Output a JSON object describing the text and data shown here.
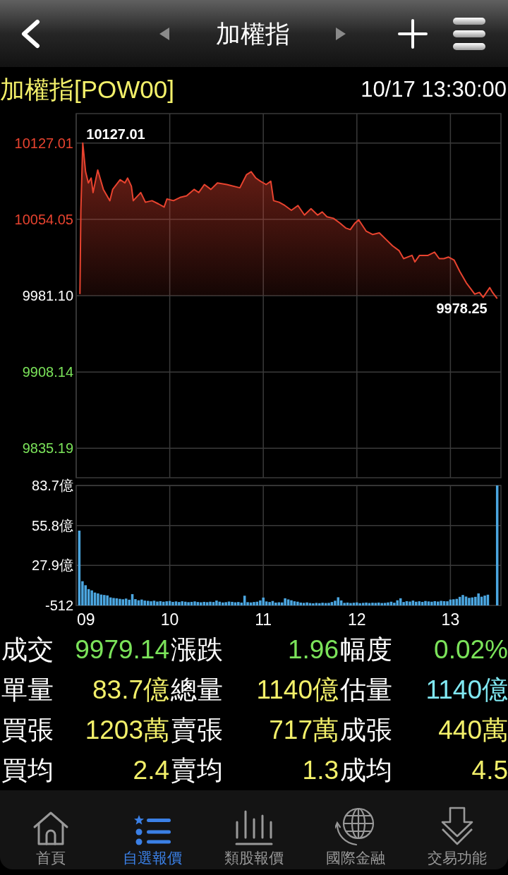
{
  "header": {
    "title": "加權指"
  },
  "quote": {
    "name": "加權指[POW00]",
    "time": "10/17 13:30:00"
  },
  "price_chart": {
    "chart_data": {
      "type": "area",
      "grid": true,
      "x": [
        9.04,
        9.05,
        9.07,
        9.1,
        9.13,
        9.16,
        9.18,
        9.23,
        9.29,
        9.36,
        9.39,
        9.47,
        9.52,
        9.55,
        9.59,
        9.61,
        9.69,
        9.74,
        9.81,
        9.88,
        9.94,
        9.97,
        10.04,
        10.11,
        10.18,
        10.26,
        10.31,
        10.37,
        10.44,
        10.51,
        10.61,
        10.75,
        10.82,
        10.87,
        10.92,
        10.97,
        11.03,
        11.08,
        11.11,
        11.17,
        11.23,
        11.3,
        11.37,
        11.44,
        11.51,
        11.58,
        11.63,
        11.68,
        11.75,
        11.82,
        11.88,
        11.93,
        11.98,
        12.02,
        12.1,
        12.17,
        12.24,
        12.31,
        12.38,
        12.45,
        12.5,
        12.59,
        12.62,
        12.67,
        12.76,
        12.83,
        12.88,
        12.93,
        12.98,
        13.04,
        13.1,
        13.17,
        13.26,
        13.31,
        13.35,
        13.42,
        13.45,
        13.5
      ],
      "series": [
        {
          "color": "#e8432f",
          "values": [
            9982.6,
            10062.7,
            10127.0,
            10099.6,
            10088.9,
            10093.5,
            10079.6,
            10101.2,
            10082.7,
            10071.9,
            10082.7,
            10091.9,
            10088.9,
            10093.5,
            10085.8,
            10071.9,
            10079.6,
            10070.4,
            10071.9,
            10068.8,
            10065.8,
            10073.5,
            10071.9,
            10075.0,
            10076.5,
            10082.7,
            10079.6,
            10087.3,
            10082.7,
            10088.9,
            10087.3,
            10084.2,
            10096.6,
            10099.6,
            10093.5,
            10090.4,
            10087.3,
            10090.4,
            10071.9,
            10070.4,
            10067.3,
            10062.7,
            10067.3,
            10058.1,
            10064.2,
            10058.1,
            10061.1,
            10056.5,
            10055.0,
            10050.4,
            10045.8,
            10044.2,
            10050.4,
            10053.5,
            10042.7,
            10039.6,
            10041.1,
            10035.0,
            10028.8,
            10024.2,
            10016.5,
            10019.6,
            10013.4,
            10019.6,
            10019.6,
            10022.7,
            10016.5,
            10016.5,
            10018.0,
            10015.0,
            10004.2,
            9993.4,
            9982.6,
            9984.2,
            9979.5,
            9988.8,
            9984.2,
            9978.3
          ]
        }
      ],
      "xlim": [
        9,
        13.54
      ],
      "ylim": [
        9807.1,
        10155.1
      ],
      "yticks": [
        {
          "value": 10127.01,
          "label": "10127.01"
        },
        {
          "value": 10054.05,
          "label": "10054.05"
        },
        {
          "value": 9981.1,
          "label": "9981.10"
        },
        {
          "value": 9908.14,
          "label": "9908.14"
        },
        {
          "value": 9835.19,
          "label": "9835.19"
        }
      ],
      "annotations": [
        {
          "text": "10127.01",
          "x": 9.07,
          "y": 10127.01
        },
        {
          "text": "9978.25",
          "x": 13.5,
          "y": 9978.25
        }
      ]
    }
  },
  "volume_chart": {
    "baseline_label": "-512",
    "chart_data": {
      "type": "bar",
      "grid": true,
      "x": [
        9.033,
        9.067,
        9.1,
        9.133,
        9.167,
        9.2,
        9.233,
        9.267,
        9.3,
        9.333,
        9.367,
        9.4,
        9.433,
        9.467,
        9.5,
        9.533,
        9.567,
        9.6,
        9.633,
        9.667,
        9.7,
        9.733,
        9.767,
        9.8,
        9.833,
        9.867,
        9.9,
        9.933,
        9.967,
        10,
        10.033,
        10.067,
        10.1,
        10.133,
        10.167,
        10.2,
        10.233,
        10.267,
        10.3,
        10.333,
        10.367,
        10.4,
        10.433,
        10.467,
        10.5,
        10.533,
        10.567,
        10.6,
        10.633,
        10.667,
        10.7,
        10.733,
        10.767,
        10.8,
        10.833,
        10.867,
        10.9,
        10.933,
        10.967,
        11,
        11.033,
        11.067,
        11.1,
        11.133,
        11.167,
        11.2,
        11.233,
        11.267,
        11.3,
        11.333,
        11.367,
        11.4,
        11.433,
        11.467,
        11.5,
        11.533,
        11.567,
        11.6,
        11.633,
        11.667,
        11.7,
        11.733,
        11.767,
        11.8,
        11.833,
        11.867,
        11.9,
        11.933,
        11.967,
        12,
        12.033,
        12.067,
        12.1,
        12.133,
        12.167,
        12.2,
        12.233,
        12.267,
        12.3,
        12.333,
        12.367,
        12.4,
        12.433,
        12.467,
        12.5,
        12.533,
        12.567,
        12.6,
        12.633,
        12.667,
        12.7,
        12.733,
        12.767,
        12.8,
        12.833,
        12.867,
        12.9,
        12.933,
        12.967,
        13,
        13.033,
        13.067,
        13.1,
        13.133,
        13.167,
        13.2,
        13.233,
        13.267,
        13.3,
        13.333,
        13.367,
        13.4,
        13.5
      ],
      "series": [
        {
          "color": "#4ba6e0",
          "values": [
            52.2,
            16.9,
            14.1,
            11.4,
            10.5,
            9.0,
            8.4,
            7.6,
            7.3,
            7.0,
            5.6,
            5.2,
            5.0,
            4.6,
            4.3,
            4.8,
            4.0,
            7.9,
            4.4,
            3.6,
            4.1,
            3.4,
            3.2,
            2.9,
            3.3,
            2.7,
            3.0,
            2.6,
            2.9,
            3.1,
            2.5,
            2.8,
            2.4,
            2.9,
            2.6,
            2.3,
            2.5,
            2.8,
            2.4,
            2.2,
            2.5,
            2.3,
            2.6,
            2.4,
            3.4,
            2.6,
            2.1,
            2.3,
            2.7,
            2.5,
            2.2,
            2.4,
            2.0,
            6.8,
            2.3,
            2.1,
            2.4,
            2.6,
            3.5,
            5.5,
            2.8,
            2.4,
            3.1,
            2.0,
            2.2,
            2.1,
            5.0,
            4.2,
            3.6,
            2.9,
            2.6,
            2.0,
            1.8,
            2.1,
            1.7,
            1.5,
            1.8,
            1.6,
            1.9,
            1.7,
            1.8,
            2.4,
            3.3,
            5.7,
            3.5,
            1.8,
            2.0,
            1.7,
            1.9,
            2.1,
            1.6,
            1.8,
            2.0,
            1.7,
            1.9,
            1.8,
            2.0,
            1.7,
            1.8,
            2.1,
            2.6,
            1.9,
            3.6,
            5.0,
            2.4,
            3.0,
            2.7,
            3.4,
            2.6,
            2.9,
            2.5,
            3.1,
            2.8,
            2.6,
            3.0,
            2.7,
            3.2,
            3.0,
            2.9,
            4.1,
            4.3,
            4.6,
            6.0,
            7.3,
            6.2,
            5.3,
            5.6,
            6.0,
            8.4,
            6.1,
            6.9,
            7.5,
            83.7
          ]
        }
      ],
      "xlim": [
        9,
        13.54
      ],
      "ylim": [
        0,
        83.7
      ],
      "xticks": [
        {
          "value": 9,
          "label": "09"
        },
        {
          "value": 10,
          "label": "10"
        },
        {
          "value": 11,
          "label": "11"
        },
        {
          "value": 12,
          "label": "12"
        },
        {
          "value": 13,
          "label": "13"
        }
      ],
      "yticks": [
        {
          "value": 83.7,
          "label": "83.7億"
        },
        {
          "value": 55.8,
          "label": "55.8億"
        },
        {
          "value": 27.9,
          "label": "27.9億"
        }
      ]
    }
  },
  "quote_stats": [
    {
      "label": "成交",
      "value": "9979.14",
      "color": "#7be35a"
    },
    {
      "label": "漲跌",
      "value": "1.96",
      "color": "#7be35a"
    },
    {
      "label": "幅度",
      "value": "0.02%",
      "color": "#7be35a"
    },
    {
      "label": "單量",
      "value": "83.7億",
      "color": "#f3f06a"
    },
    {
      "label": "總量",
      "value": "1140億",
      "color": "#f3f06a"
    },
    {
      "label": "估量",
      "value": "1140億",
      "color": "#80e8f2"
    },
    {
      "label": "買張",
      "value": "1203萬",
      "color": "#f3f06a"
    },
    {
      "label": "賣張",
      "value": "717萬",
      "color": "#f3f06a"
    },
    {
      "label": "成張",
      "value": "440萬",
      "color": "#f3f06a"
    },
    {
      "label": "買均",
      "value": "2.4",
      "color": "#f3f06a"
    },
    {
      "label": "賣均",
      "value": "1.3",
      "color": "#f3f06a"
    },
    {
      "label": "成均",
      "value": "4.5",
      "color": "#f3f06a"
    }
  ],
  "tab_bar": [
    {
      "label": "首頁",
      "selected": false
    },
    {
      "label": "自選報價",
      "selected": true
    },
    {
      "label": "類股報價",
      "selected": false
    },
    {
      "label": "國際金融",
      "selected": false
    },
    {
      "label": "交易功能",
      "selected": false
    }
  ]
}
